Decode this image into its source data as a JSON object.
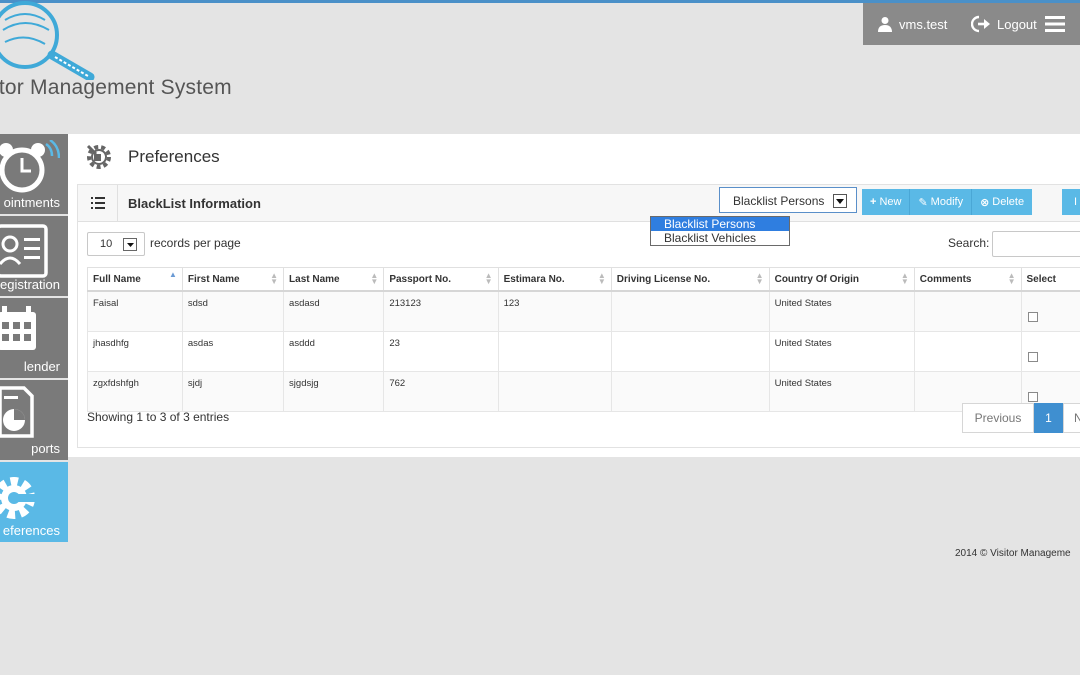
{
  "header": {
    "username": "vms.test",
    "logout_label": "Logout",
    "logo_text": "itor Management System",
    "user_icon": "user-icon",
    "logout_icon": "logout-icon",
    "menu_icon": "hamburger-icon"
  },
  "sidebar": {
    "items": [
      {
        "label": "ointments",
        "icon": "alarm-clock-icon",
        "active": false
      },
      {
        "label": "egistration",
        "icon": "id-card-icon",
        "active": false
      },
      {
        "label": "lender",
        "icon": "calendar-icon",
        "active": false
      },
      {
        "label": "ports",
        "icon": "report-icon",
        "active": false
      },
      {
        "label": "eferences",
        "icon": "gear-icon",
        "active": true
      }
    ]
  },
  "page": {
    "title": "Preferences"
  },
  "box": {
    "title": "BlackList Information",
    "select_value": "Blacklist Persons",
    "select_options": [
      "Blacklist Persons",
      "Blacklist Vehicles"
    ],
    "buttons": {
      "new": "New",
      "modify": "Modify",
      "delete": "Delete",
      "extra": "I"
    }
  },
  "table": {
    "length_value": "10",
    "length_label": "records per page",
    "search_label": "Search:",
    "columns": [
      "Full Name",
      "First Name",
      "Last Name",
      "Passport No.",
      "Estimara No.",
      "Driving License No.",
      "Country Of Origin",
      "Comments",
      "Select"
    ],
    "rows": [
      [
        "Faisal",
        "sdsd",
        "asdasd",
        "213123",
        "123",
        "",
        "United States",
        ""
      ],
      [
        "jhasdhfg",
        "asdas",
        "asddd",
        "23",
        "",
        "",
        "United States",
        ""
      ],
      [
        "zgxfdshfgh",
        "sjdj",
        "sjgdsjg",
        "762",
        "",
        "",
        "United States",
        ""
      ]
    ],
    "info": "Showing 1 to 3 of 3 entries",
    "pager": {
      "previous": "Previous",
      "current": "1",
      "next": "N"
    }
  },
  "footer": {
    "text": "2014 © Visitor Manageme"
  },
  "colors": {
    "accent": "#5ab9e6",
    "sidebar": "#7a7a7a",
    "page_current": "#3f8fd0"
  }
}
